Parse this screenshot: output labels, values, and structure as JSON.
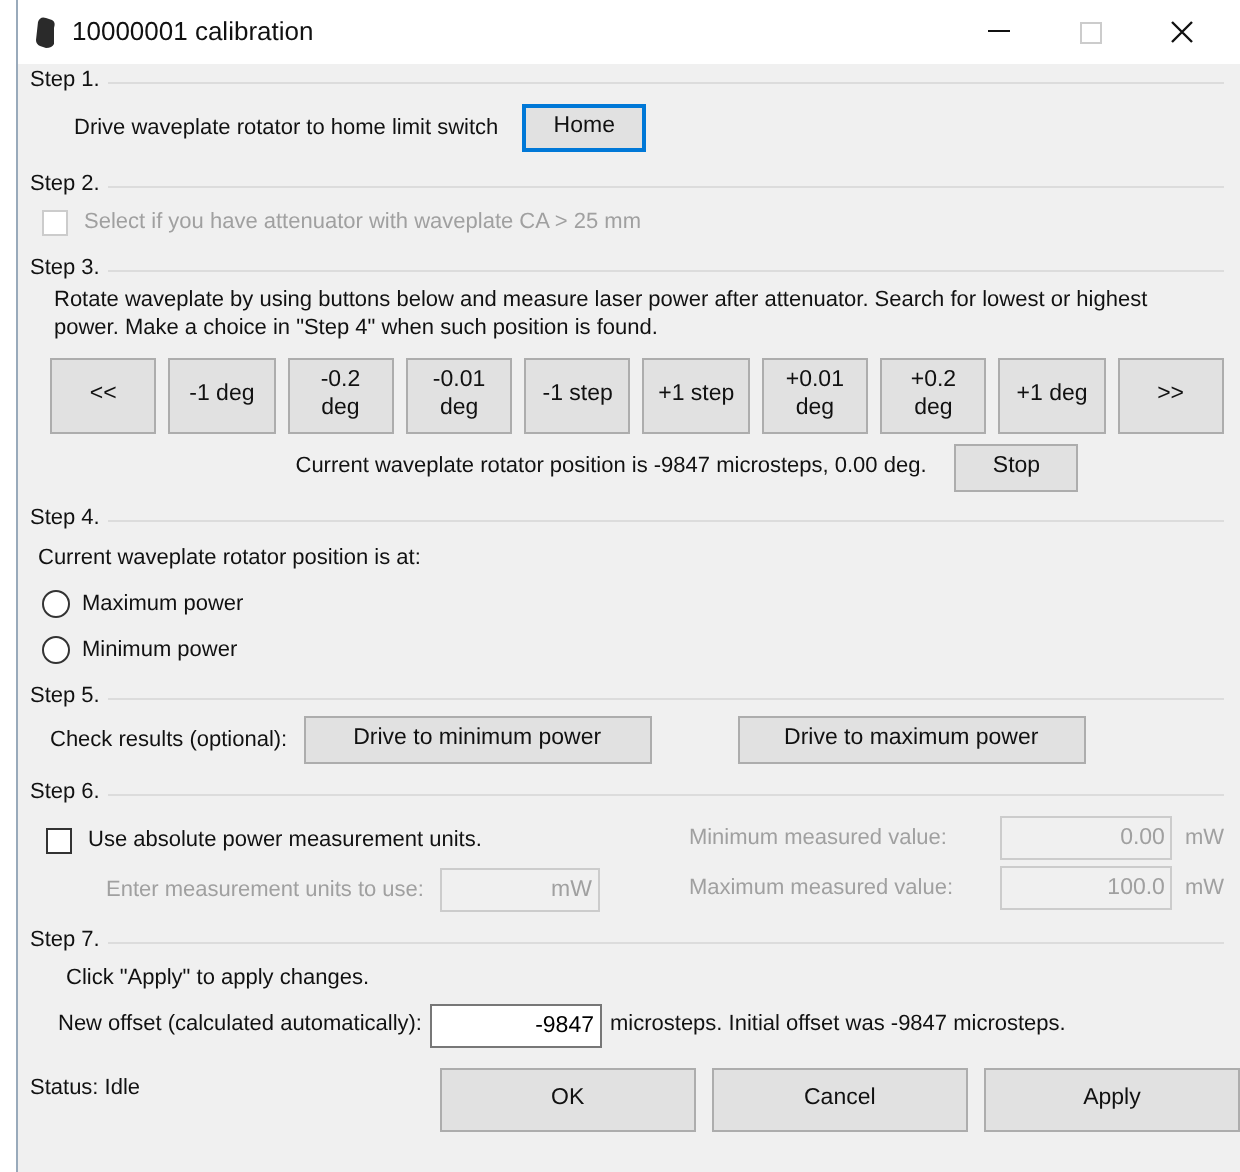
{
  "window": {
    "title": "10000001 calibration"
  },
  "step1": {
    "heading": "Step 1.",
    "label": "Drive waveplate rotator to home limit switch",
    "button": "Home"
  },
  "step2": {
    "heading": "Step 2.",
    "checkbox": {
      "label": "Select if you have attenuator with waveplate CA > 25 mm",
      "checked": false,
      "disabled": true
    }
  },
  "step3": {
    "heading": "Step 3.",
    "text": "Rotate waveplate by using buttons below and measure laser power after attenuator. Search for lowest or highest power. Make a choice in \"Step 4\" when such position is found.",
    "buttons": [
      "<<",
      "-1 deg",
      "-0.2\ndeg",
      "-0.01\ndeg",
      "-1 step",
      "+1 step",
      "+0.01\ndeg",
      "+0.2\ndeg",
      "+1 deg",
      ">>"
    ],
    "position": "Current waveplate rotator position is -9847 microsteps, 0.00 deg.",
    "stop_button": "Stop"
  },
  "step4": {
    "heading": "Step 4.",
    "text": "Current waveplate rotator position is at:",
    "options": [
      {
        "label": "Maximum power",
        "selected": false
      },
      {
        "label": "Minimum power",
        "selected": false
      }
    ]
  },
  "step5": {
    "heading": "Step 5.",
    "label": "Check results (optional):",
    "buttons": [
      "Drive to minimum power",
      "Drive to maximum power"
    ]
  },
  "step6": {
    "heading": "Step 6.",
    "checkbox": {
      "label": "Use absolute power measurement units.",
      "checked": false
    },
    "disabled": true,
    "units_label": "Enter measurement units to use:",
    "units_value": "mW",
    "min_label": "Minimum measured value:",
    "min_value": "0.00",
    "min_unit": "mW",
    "max_label": "Maximum measured value:",
    "max_value": "100.0",
    "max_unit": "mW"
  },
  "step7": {
    "heading": "Step 7.",
    "text": "Click \"Apply\" to apply changes.",
    "offset_label": "New offset (calculated automatically):",
    "offset_value": "-9847",
    "offset_note": "microsteps.  Initial offset was -9847 microsteps."
  },
  "status": "Status: Idle",
  "buttons": [
    "OK",
    "Cancel",
    "Apply"
  ]
}
